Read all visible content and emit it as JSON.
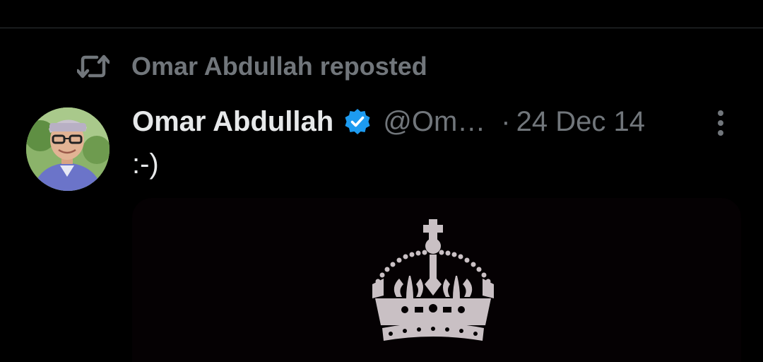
{
  "repost": {
    "text": "Omar Abdullah reposted",
    "icon": "repost-icon"
  },
  "tweet": {
    "display_name": "Omar Abdullah",
    "handle": "@Om…",
    "separator": "·",
    "date": "24 Dec 14",
    "text": ":-)",
    "verified_icon": "verified-badge-icon",
    "more_icon": "more-options-icon",
    "media_icon": "crown-icon"
  },
  "colors": {
    "background": "#000000",
    "primary_text": "#e7e9ea",
    "secondary_text": "#71767b",
    "verified_blue": "#1d9bf0",
    "divider": "#2f3336"
  }
}
